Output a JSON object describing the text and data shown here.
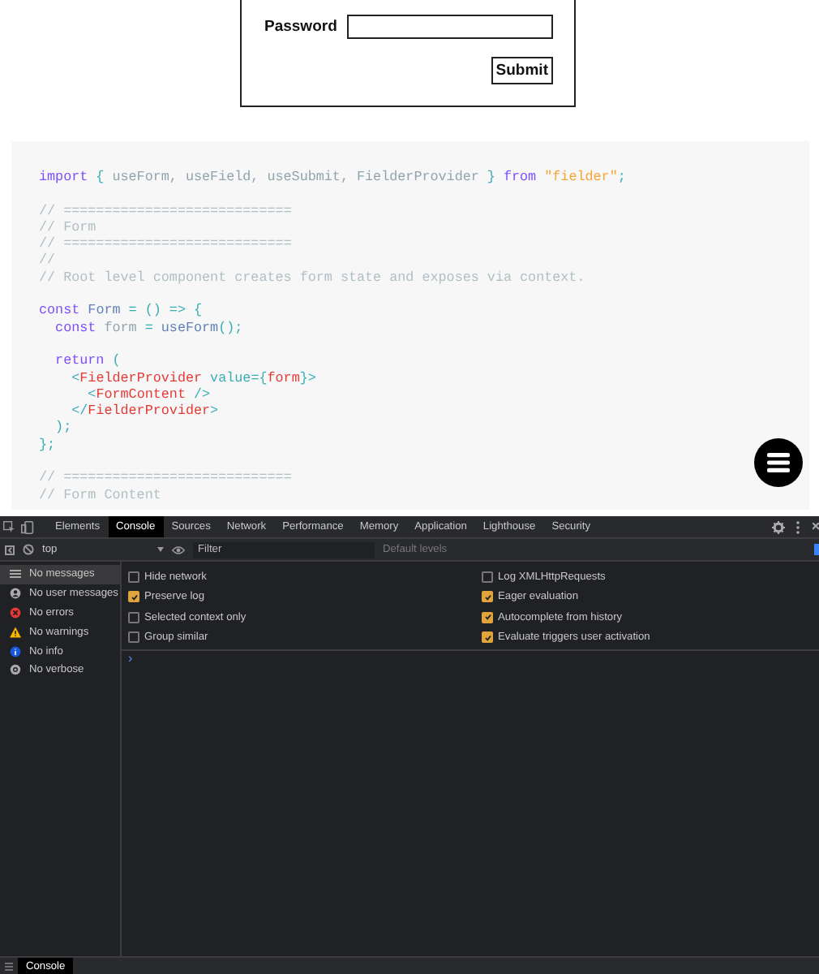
{
  "form": {
    "password_label": "Password",
    "submit": "Submit"
  },
  "code": {
    "blocks": [
      {
        "lines": [
          [
            {
              "kind": "kw",
              "text": "import"
            },
            {
              "kind": "punc",
              "text": " { "
            },
            {
              "kind": "plain",
              "text": "useForm, useField, useSubmit, FielderProvider"
            },
            {
              "kind": "punc",
              "text": " } "
            },
            {
              "kind": "kw",
              "text": "from"
            },
            {
              "kind": "str",
              "text": " \"fielder\""
            },
            {
              "kind": "punc",
              "text": ";"
            }
          ]
        ]
      },
      {
        "lines": [
          [
            {
              "kind": "comment",
              "text": "// ============================"
            }
          ],
          [
            {
              "kind": "comment",
              "text": "// Form"
            }
          ],
          [
            {
              "kind": "comment",
              "text": "// ============================"
            }
          ],
          [
            {
              "kind": "comment",
              "text": "//"
            }
          ],
          [
            {
              "kind": "comment",
              "text": "// Root level component creates form state and exposes via context."
            }
          ]
        ]
      },
      {
        "lines": [
          [
            {
              "kind": "kw",
              "text": "const"
            },
            {
              "kind": "fn",
              "text": " Form"
            },
            {
              "kind": "punc",
              "text": " = () => {"
            }
          ],
          [
            {
              "kind": "kw",
              "text": "  const"
            },
            {
              "kind": "plain",
              "text": " form "
            },
            {
              "kind": "punc",
              "text": "= "
            },
            {
              "kind": "fn",
              "text": "useForm"
            },
            {
              "kind": "punc",
              "text": "();"
            }
          ]
        ]
      },
      {
        "lines": [
          [
            {
              "kind": "kw",
              "text": "  return"
            },
            {
              "kind": "punc",
              "text": " ("
            }
          ],
          [
            {
              "kind": "punc",
              "text": "    <"
            },
            {
              "kind": "tag",
              "text": "FielderProvider"
            },
            {
              "kind": "attr",
              "text": " value"
            },
            {
              "kind": "punc",
              "text": "={"
            },
            {
              "kind": "tag",
              "text": "form"
            },
            {
              "kind": "punc",
              "text": "}>"
            }
          ],
          [
            {
              "kind": "punc",
              "text": "      <"
            },
            {
              "kind": "tag",
              "text": "FormContent"
            },
            {
              "kind": "punc",
              "text": " />"
            }
          ],
          [
            {
              "kind": "punc",
              "text": "    </"
            },
            {
              "kind": "tag",
              "text": "FielderProvider"
            },
            {
              "kind": "punc",
              "text": ">"
            }
          ],
          [
            {
              "kind": "punc",
              "text": "  );"
            }
          ],
          [
            {
              "kind": "punc",
              "text": "};"
            }
          ]
        ]
      },
      {
        "lines": [
          [
            {
              "kind": "comment",
              "text": "// ============================"
            }
          ],
          [
            {
              "kind": "comment",
              "text": "// Form Content"
            }
          ]
        ]
      }
    ]
  },
  "devtools": {
    "tabs": [
      {
        "label": "Elements",
        "selected": false
      },
      {
        "label": "Console",
        "selected": true
      },
      {
        "label": "Sources",
        "selected": false
      },
      {
        "label": "Network",
        "selected": false
      },
      {
        "label": "Performance",
        "selected": false
      },
      {
        "label": "Memory",
        "selected": false
      },
      {
        "label": "Application",
        "selected": false
      },
      {
        "label": "Lighthouse",
        "selected": false
      },
      {
        "label": "Security",
        "selected": false
      }
    ],
    "context": "top",
    "filter_placeholder": "Filter",
    "levels": "Default levels",
    "sidebar": [
      {
        "kind": "list",
        "label": "No messages",
        "selected": true
      },
      {
        "kind": "user",
        "label": "No user messages",
        "selected": false
      },
      {
        "kind": "error",
        "label": "No errors",
        "selected": false
      },
      {
        "kind": "warning",
        "label": "No warnings",
        "selected": false
      },
      {
        "kind": "info",
        "label": "No info",
        "selected": false
      },
      {
        "kind": "verbose",
        "label": "No verbose",
        "selected": false
      }
    ],
    "settings_left": [
      {
        "label": "Hide network",
        "checked": false
      },
      {
        "label": "Preserve log",
        "checked": true
      },
      {
        "label": "Selected context only",
        "checked": false
      },
      {
        "label": "Group similar",
        "checked": false
      }
    ],
    "settings_right": [
      {
        "label": "Log XMLHttpRequests",
        "checked": false
      },
      {
        "label": "Eager evaluation",
        "checked": true
      },
      {
        "label": "Autocomplete from history",
        "checked": true
      },
      {
        "label": "Evaluate triggers user activation",
        "checked": true
      }
    ],
    "prompt": "›",
    "drawer_tab": "Console"
  }
}
